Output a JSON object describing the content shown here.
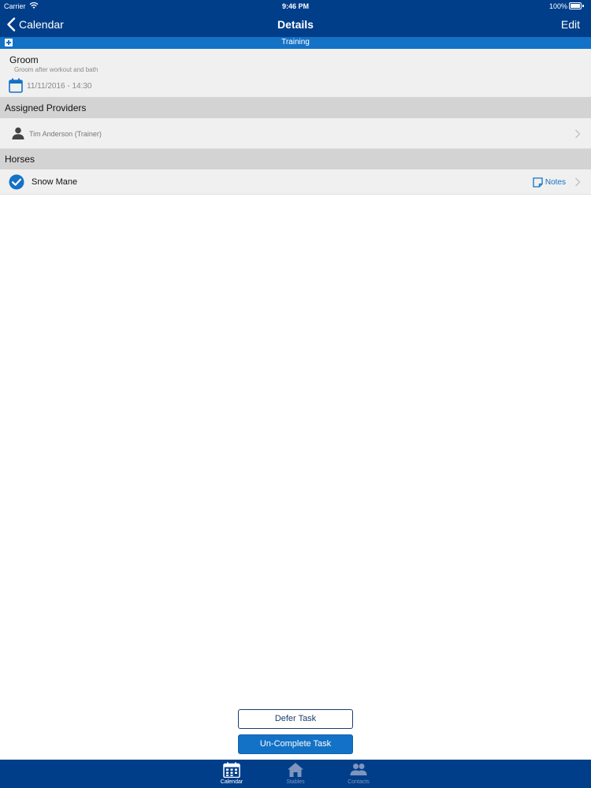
{
  "status_bar": {
    "carrier": "Carrier",
    "time": "9:46 PM",
    "battery": "100%"
  },
  "nav": {
    "back_label": "Calendar",
    "title": "Details",
    "edit_label": "Edit"
  },
  "category": {
    "label": "Training"
  },
  "task": {
    "title": "Groom",
    "description": "Groom after workout and bath",
    "datetime": "11/11/2016 - 14:30"
  },
  "sections": {
    "providers_header": "Assigned Providers",
    "horses_header": "Horses"
  },
  "providers": [
    {
      "name": "Tim Anderson (Trainer)"
    }
  ],
  "horses": [
    {
      "name": "Snow Mane",
      "notes_label": "Notes",
      "completed": true
    }
  ],
  "actions": {
    "defer_label": "Defer Task",
    "uncomplete_label": "Un-Complete Task"
  },
  "tabs": [
    {
      "label": "Calendar",
      "icon": "calendar-icon",
      "selected": true
    },
    {
      "label": "Stables",
      "icon": "stable-icon",
      "selected": false
    },
    {
      "label": "Contacts",
      "icon": "contacts-icon",
      "selected": false
    }
  ],
  "colors": {
    "nav_blue": "#003e8a",
    "accent_blue": "#1372c6",
    "row_bg": "#f0f0f0",
    "section_bg": "#d3d3d3",
    "tab_inactive": "#7f95bd"
  }
}
